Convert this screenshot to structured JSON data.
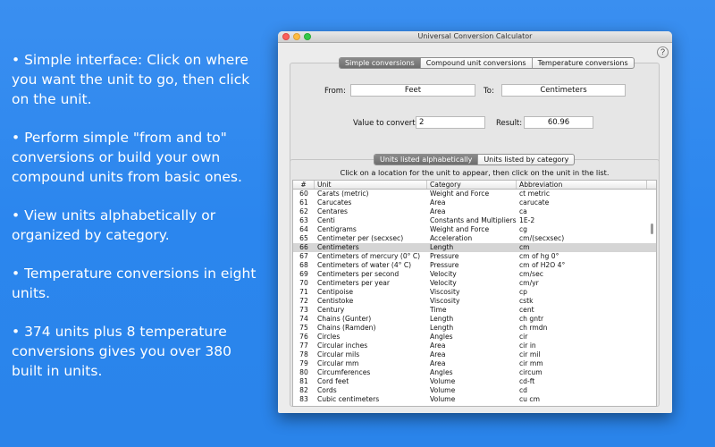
{
  "features": [
    "• Simple interface: Click on where you want the unit to go, then click on the unit.",
    "•  Perform simple \"from and to\" conversions or build your own compound units from basic ones.",
    "•  View units alphabetically or organized by category.",
    "•  Temperature conversions in eight units.",
    "•  374 units plus 8 temperature conversions gives you over 380 built in units."
  ],
  "window": {
    "title": "Universal Conversion Calculator",
    "help": "?"
  },
  "tabs": [
    {
      "label": "Simple conversions",
      "active": true
    },
    {
      "label": "Compound unit conversions",
      "active": false
    },
    {
      "label": "Temperature conversions",
      "active": false
    }
  ],
  "converter": {
    "from_label": "From:",
    "from_value": "Feet",
    "to_label": "To:",
    "to_value": "Centimeters",
    "value_label": "Value to convert:",
    "value": "2",
    "result_label": "Result:",
    "result": "60.96"
  },
  "list_tabs": [
    {
      "label": "Units listed alphabetically",
      "active": true
    },
    {
      "label": "Units listed by category",
      "active": false
    }
  ],
  "instruction": "Click on a location for the unit to appear, then click on the unit in the list.",
  "table": {
    "headers": [
      "#",
      "Unit",
      "Category",
      "Abbreviation"
    ],
    "rows": [
      [
        "60",
        "Carats (metric)",
        "Weight and Force",
        "ct metric"
      ],
      [
        "61",
        "Carucates",
        "Area",
        "carucate"
      ],
      [
        "62",
        "Centares",
        "Area",
        "ca"
      ],
      [
        "63",
        "Centi",
        "Constants and Multipliers",
        "1E-2"
      ],
      [
        "64",
        "Centigrams",
        "Weight and Force",
        "cg"
      ],
      [
        "65",
        "Centimeter per (secxsec)",
        "Acceleration",
        "cm/(secxsec)"
      ],
      [
        "66",
        "Centimeters",
        "Length",
        "cm"
      ],
      [
        "67",
        "Centimeters of mercury (0° C)",
        "Pressure",
        "cm of hg 0°"
      ],
      [
        "68",
        "Centimeters of water (4° C)",
        "Pressure",
        "cm of H2O 4°"
      ],
      [
        "69",
        "Centimeters per second",
        "Velocity",
        "cm/sec"
      ],
      [
        "70",
        "Centimeters per year",
        "Velocity",
        "cm/yr"
      ],
      [
        "71",
        "Centipoise",
        "Viscosity",
        "cp"
      ],
      [
        "72",
        "Centistoke",
        "Viscosity",
        "cstk"
      ],
      [
        "73",
        "Century",
        "Time",
        "cent"
      ],
      [
        "74",
        "Chains (Gunter)",
        "Length",
        "ch gntr"
      ],
      [
        "75",
        "Chains (Ramden)",
        "Length",
        "ch rmdn"
      ],
      [
        "76",
        "Circles",
        "Angles",
        "cir"
      ],
      [
        "77",
        "Circular inches",
        "Area",
        "cir in"
      ],
      [
        "78",
        "Circular mils",
        "Area",
        "cir mil"
      ],
      [
        "79",
        "Circular mm",
        "Area",
        "cir mm"
      ],
      [
        "80",
        "Circumferences",
        "Angles",
        "circum"
      ],
      [
        "81",
        "Cord feet",
        "Volume",
        "cd-ft"
      ],
      [
        "82",
        "Cords",
        "Volume",
        "cd"
      ],
      [
        "83",
        "Cubic centimeters",
        "Volume",
        "cu cm"
      ]
    ],
    "selected_index": 6
  }
}
